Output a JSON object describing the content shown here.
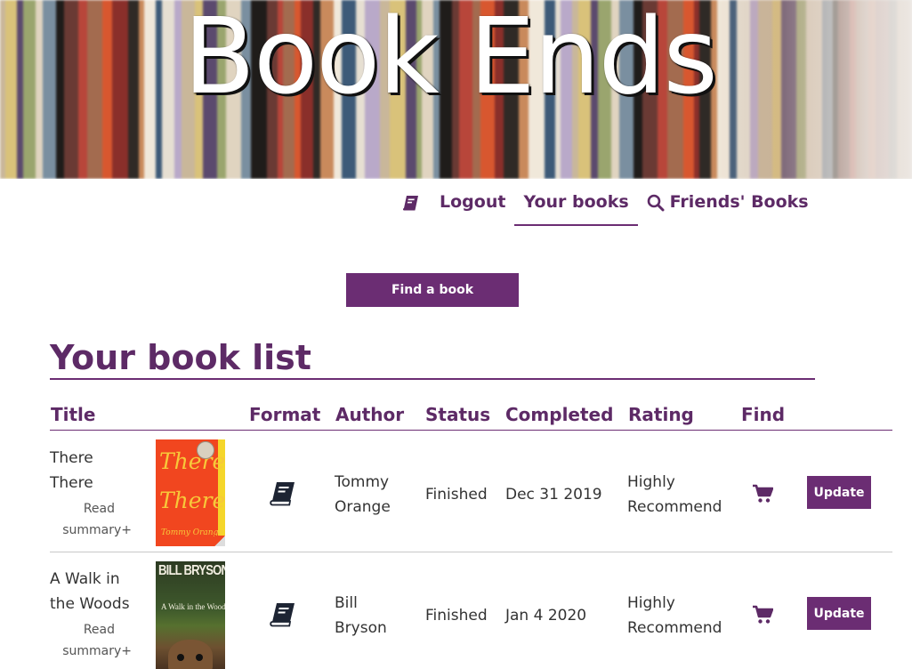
{
  "site": {
    "title": "Book Ends"
  },
  "nav": {
    "items": [
      {
        "label": "Logout"
      },
      {
        "label": "Your books"
      },
      {
        "label": "Friends' Books"
      }
    ]
  },
  "find_button": "Find a book",
  "list_heading": "Your book list",
  "table": {
    "headers": [
      "Title",
      "Format",
      "Author",
      "Status",
      "Completed",
      "Rating",
      "Find"
    ],
    "rows": [
      {
        "title_line1": "There",
        "title_line2": "There",
        "summary_line1": "Read",
        "summary_line2": "summary+",
        "cover_title_line1": "There",
        "cover_title_line2": "There",
        "cover_author": "Tommy Orange",
        "author_line1": "Tommy",
        "author_line2": "Orange",
        "status": "Finished",
        "completed": "Dec 31 2019",
        "rating_line1": "Highly",
        "rating_line2": "Recommend",
        "format_icon": "book-icon",
        "find_icon": "cart-icon",
        "update_label": "Update"
      },
      {
        "title_line1": "A Walk in",
        "title_line2": "the Woods",
        "summary_line1": "Read",
        "summary_line2": "summary+",
        "cover_author": "BILL BRYSON",
        "cover_title": "A Walk in the Woods",
        "author_line1": "Bill",
        "author_line2": "Bryson",
        "status": "Finished",
        "completed": "Jan 4 2020",
        "rating_line1": "Highly",
        "rating_line2": "Recommend",
        "format_icon": "book-icon",
        "find_icon": "cart-icon",
        "update_label": "Update"
      }
    ]
  },
  "colors": {
    "accent": "#6b2d73",
    "heading": "#5d2a66"
  }
}
